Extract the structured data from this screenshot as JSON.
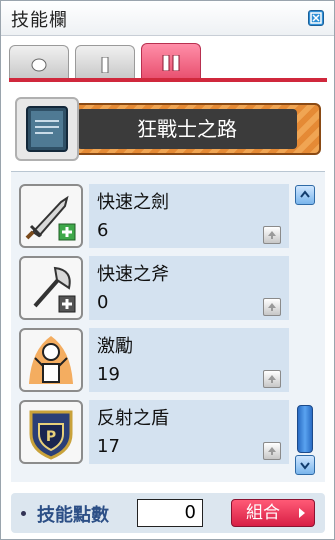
{
  "window": {
    "title": "技能欄"
  },
  "tabs": [
    {
      "id": "beginner"
    },
    {
      "id": "tier1"
    },
    {
      "id": "tier2",
      "active": true
    }
  ],
  "job": {
    "title": "狂戰士之路"
  },
  "skills": [
    {
      "name": "快速之劍",
      "level": "6",
      "icon": "sword-icon"
    },
    {
      "name": "快速之斧",
      "level": "0",
      "icon": "axe-icon"
    },
    {
      "name": "激勵",
      "level": "19",
      "icon": "rage-icon"
    },
    {
      "name": "反射之盾",
      "level": "17",
      "icon": "shield-icon"
    }
  ],
  "footer": {
    "points_label": "技能點數",
    "points_value": "0",
    "combine_label": "組合"
  },
  "colors": {
    "active_tab": "#e8506f",
    "accent_red": "#d0283c",
    "banner_orange": "#e58a35",
    "row_bg": "#d4e2f0",
    "combine_btn": "#d81f45"
  }
}
